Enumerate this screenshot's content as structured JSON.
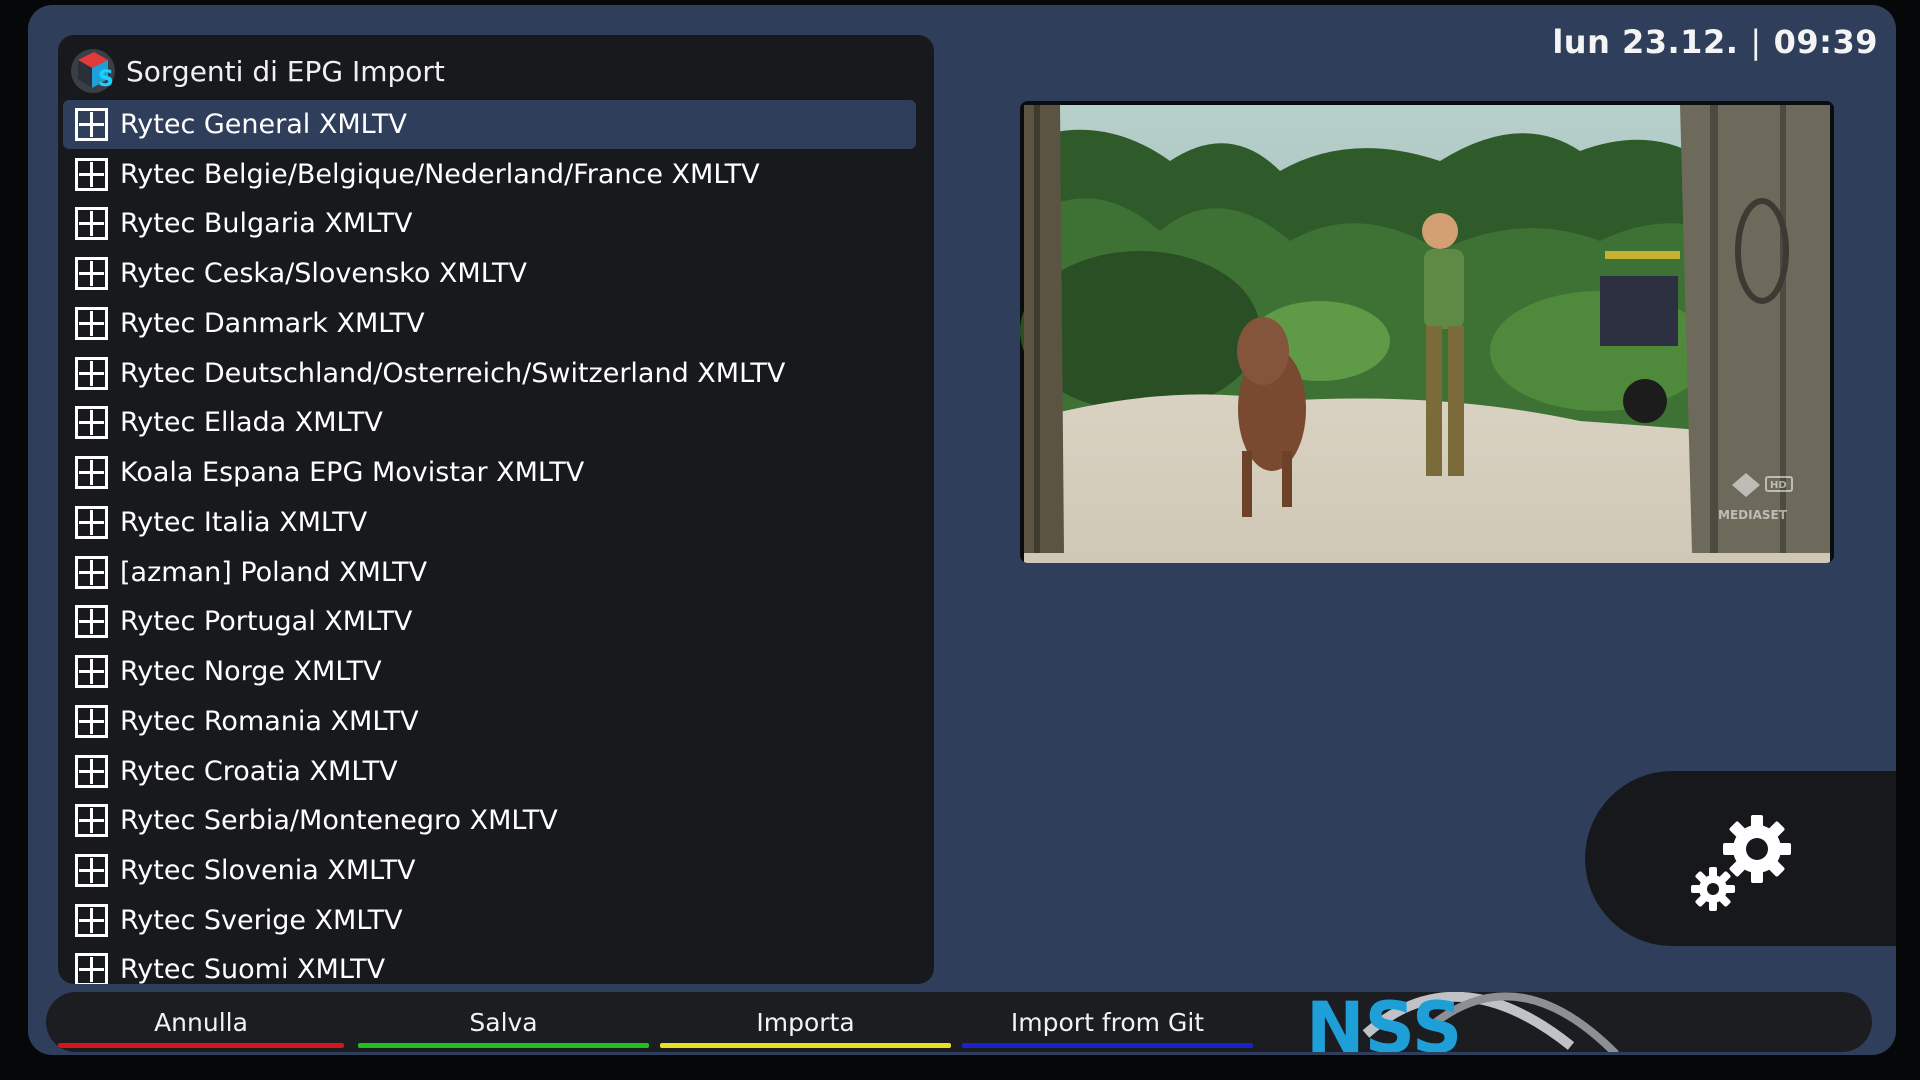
{
  "header": {
    "title": "Sorgenti di EPG Import",
    "date": "lun 23.12.",
    "separator": "|",
    "time": "09:39"
  },
  "sources": [
    {
      "label": "Rytec General XMLTV",
      "selected": true
    },
    {
      "label": "Rytec Belgie/Belgique/Nederland/France XMLTV"
    },
    {
      "label": "Rytec Bulgaria XMLTV"
    },
    {
      "label": "Rytec Ceska/Slovensko XMLTV"
    },
    {
      "label": "Rytec Danmark XMLTV"
    },
    {
      "label": "Rytec Deutschland/Osterreich/Switzerland XMLTV"
    },
    {
      "label": "Rytec Ellada XMLTV"
    },
    {
      "label": "Koala Espana EPG Movistar XMLTV"
    },
    {
      "label": "Rytec Italia XMLTV"
    },
    {
      "label": "[azman] Poland XMLTV"
    },
    {
      "label": "Rytec Portugal XMLTV"
    },
    {
      "label": "Rytec Norge XMLTV"
    },
    {
      "label": "Rytec Romania XMLTV"
    },
    {
      "label": "Rytec Croatia XMLTV"
    },
    {
      "label": "Rytec Serbia/Montenegro XMLTV"
    },
    {
      "label": "Rytec Slovenia XMLTV"
    },
    {
      "label": "Rytec Sverige XMLTV"
    },
    {
      "label": "Rytec Suomi XMLTV"
    }
  ],
  "buttons": {
    "red": {
      "label": "Annulla",
      "color": "#d3151f"
    },
    "green": {
      "label": "Salva",
      "color": "#20c020"
    },
    "yellow": {
      "label": "Importa",
      "color": "#e8e020"
    },
    "blue": {
      "label": "Import from Git",
      "color": "#1b22c8"
    }
  },
  "video": {
    "channel_logo": "mediaset-italia-hd-logo",
    "watermark": "MEDIASET",
    "hd_badge": "HD"
  },
  "brand": {
    "text": "NSS",
    "icon": "nss-logo"
  },
  "icons": {
    "header": "epg-import-logo",
    "expand": "plus-box-icon",
    "settings": "gears-icon"
  },
  "colors": {
    "background": "#2f3e5a",
    "panel": "#17191c",
    "selection": "#2f3e5a",
    "brand_blue": "#1e9fd8",
    "brand_red": "#e0303a"
  }
}
